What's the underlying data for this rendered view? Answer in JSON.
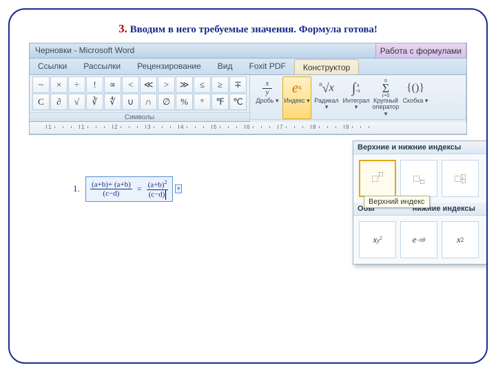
{
  "instruction": {
    "number": "3.",
    "text": "Вводим в него требуемые значения. Формула готова!"
  },
  "title": {
    "doc": "Черновки",
    "app": "Microsoft Word"
  },
  "context_tab": "Работа с формулами",
  "tabs": [
    "Ссылки",
    "Рассылки",
    "Рецензирование",
    "Вид",
    "Foxit PDF",
    "Конструктор"
  ],
  "active_tab_index": 5,
  "ribbon": {
    "symbols_label": "Символы",
    "symbols": [
      "~",
      "×",
      "÷",
      "!",
      "∝",
      "<",
      "≪",
      ">",
      "≫",
      "≤",
      "≥",
      "∓",
      "C",
      "∂",
      "√",
      "∛",
      "∜",
      "∪",
      "∩",
      "∅",
      "%",
      "°",
      "℉",
      "℃"
    ],
    "structs": [
      {
        "label": "Дробь",
        "icon": "x/y"
      },
      {
        "label": "Индекс",
        "icon": "eˣ"
      },
      {
        "label": "Радикал",
        "icon": "ⁿ√x"
      },
      {
        "label": "Интеграл",
        "icon": "∫"
      },
      {
        "label": "Крупный оператор",
        "icon": "Σ"
      },
      {
        "label": "Скобка",
        "icon": "{()}"
      }
    ],
    "hot_index": 1
  },
  "ruler_labels": [
    "1",
    "1",
    "2",
    "3",
    "4",
    "5",
    "6",
    "7",
    "8",
    "9"
  ],
  "formula": {
    "list_num": "1.",
    "lhs_num": "(a+b)+ (a+b)",
    "lhs_den": "(c−d)",
    "rhs_num_base": "(a+b)",
    "rhs_num_sup": "2",
    "rhs_den": "(c−d)"
  },
  "gallery": {
    "header1": "Верхние и нижние индексы",
    "header2_left": "Обы",
    "header2_right": "нижние индексы",
    "tooltip": "Верхний индекс",
    "row2": [
      "x_{y²}",
      "e^{−tiθ}",
      "x²"
    ]
  }
}
